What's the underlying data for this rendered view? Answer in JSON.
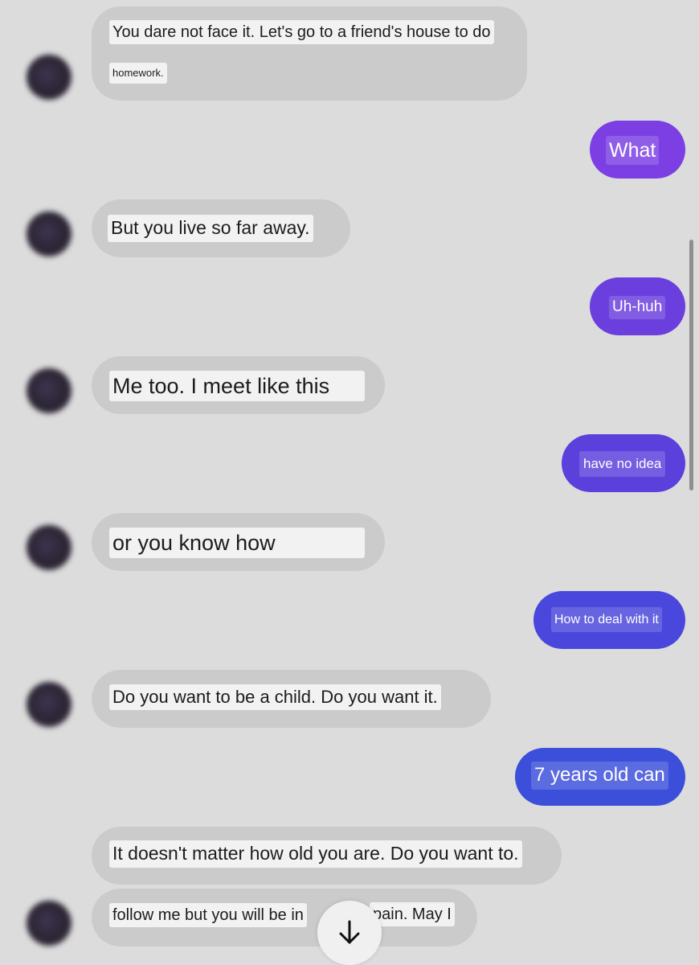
{
  "messages": [
    {
      "from": "other",
      "lines": [
        "You dare not face it. Let's go to a friend's house to do",
        "homework."
      ]
    },
    {
      "from": "me",
      "text": "What",
      "color": "#7b3fe4"
    },
    {
      "from": "other",
      "lines": [
        "But you live so far away."
      ]
    },
    {
      "from": "me",
      "text": "Uh-huh",
      "color": "#6a3fde"
    },
    {
      "from": "other",
      "lines": [
        "Me too. I meet like this"
      ]
    },
    {
      "from": "me",
      "text": "have no idea",
      "color": "#5b40dc"
    },
    {
      "from": "other",
      "lines": [
        "or you know how"
      ]
    },
    {
      "from": "me",
      "text": "How to deal with it",
      "color": "#4a47dc"
    },
    {
      "from": "other",
      "lines": [
        "Do you want to be a child. Do you want it."
      ]
    },
    {
      "from": "me",
      "text": "7 years old can",
      "color": "#3c4fda"
    },
    {
      "from": "other",
      "lines": [
        "It doesn't matter how old you are. Do you want to."
      ]
    },
    {
      "from": "other",
      "lines": [
        "follow me but you will be in",
        "pain. May I"
      ]
    }
  ],
  "icons": {
    "scroll_down": "arrow-down-icon",
    "avatar": "avatar"
  }
}
